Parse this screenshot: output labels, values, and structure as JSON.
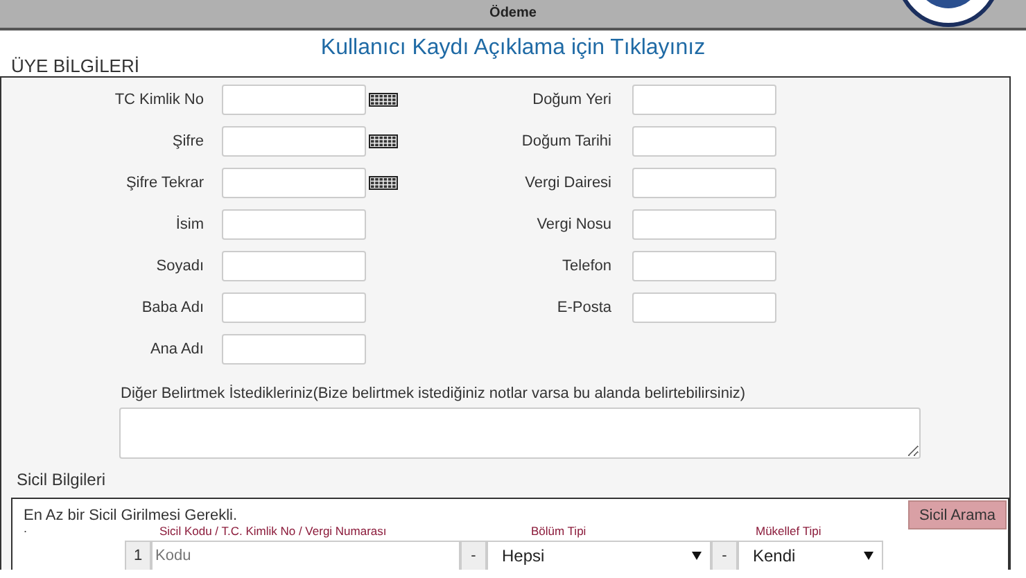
{
  "nav": {
    "items": [
      "Ödeme"
    ]
  },
  "banner": {
    "link": "Kullanıcı Kaydı Açıklama için Tıklayınız"
  },
  "member_section": {
    "title": "ÜYE BİLGİLERİ",
    "left_fields": [
      {
        "label": "TC Kimlik No",
        "keyboard": true
      },
      {
        "label": "Şifre",
        "keyboard": true
      },
      {
        "label": "Şifre Tekrar",
        "keyboard": true
      },
      {
        "label": "İsim",
        "keyboard": false
      },
      {
        "label": "Soyadı",
        "keyboard": false
      },
      {
        "label": "Baba Adı",
        "keyboard": false
      },
      {
        "label": "Ana Adı",
        "keyboard": false
      }
    ],
    "right_fields": [
      {
        "label": "Doğum Yeri"
      },
      {
        "label": "Doğum Tarihi"
      },
      {
        "label": "Vergi Dairesi"
      },
      {
        "label": "Vergi Nosu"
      },
      {
        "label": "Telefon"
      },
      {
        "label": "E-Posta"
      }
    ],
    "notes_label": "Diğer Belirtmek İstedikleriniz(Bize belirtmek istediğiniz notlar varsa bu alanda belirtebilirsiniz)"
  },
  "registry": {
    "title": "Sicil Bilgileri",
    "message": "En Az bir Sicil Girilmesi Gerekli.",
    "search_button": "Sicil Arama",
    "marker": ".",
    "columns": [
      "Sicil Kodu / T.C. Kimlik No / Vergi Numarası",
      "Bölüm Tipi",
      "Mükellef Tipi"
    ],
    "rows": [
      {
        "index": "1",
        "code_placeholder": "Kodu",
        "separator_1": "-",
        "section": "Hepsi",
        "separator_2": "-",
        "taxpayer": "Kendi"
      }
    ]
  }
}
